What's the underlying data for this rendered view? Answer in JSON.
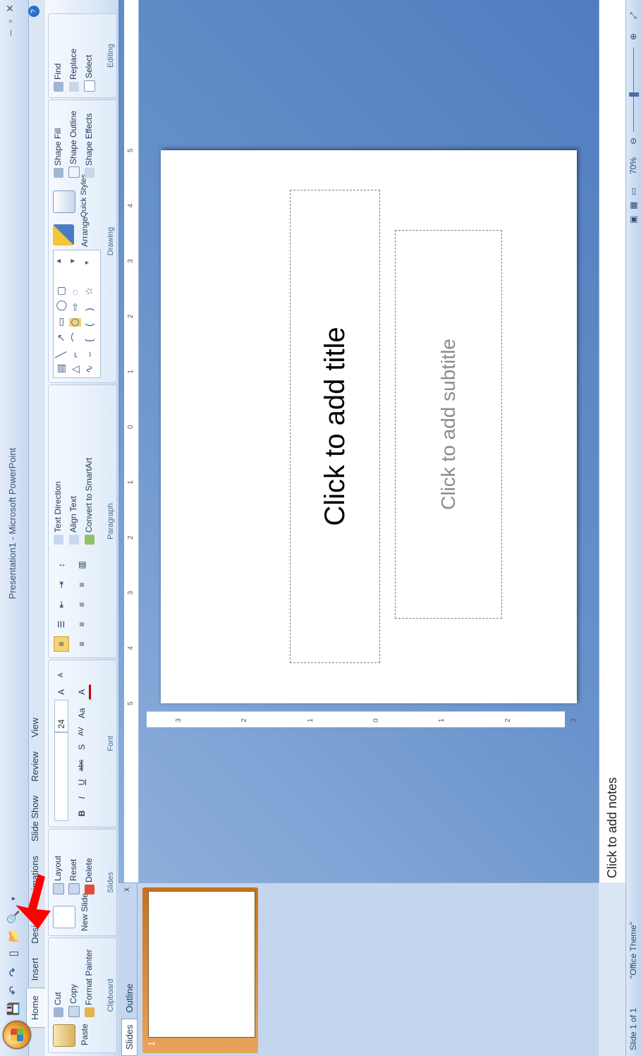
{
  "window": {
    "title": "Presentation1 - Microsoft PowerPoint",
    "controls": [
      "–",
      "▫",
      "✕"
    ]
  },
  "quick_access": [
    "save-icon",
    "undo-icon",
    "redo-icon",
    "new-icon",
    "open-icon",
    "print-preview-icon"
  ],
  "tabs": [
    "Home",
    "Insert",
    "Design",
    "Animations",
    "Slide Show",
    "Review",
    "View"
  ],
  "active_tab": "Home",
  "ribbon": {
    "clipboard": {
      "label": "Clipboard",
      "paste": "Paste",
      "cut": "Cut",
      "copy": "Copy",
      "format_painter": "Format Painter"
    },
    "slides": {
      "label": "Slides",
      "new_slide": "New Slide",
      "layout": "Layout",
      "reset": "Reset",
      "delete": "Delete"
    },
    "font": {
      "label": "Font",
      "font_name": "",
      "font_size": "24",
      "bold": "B",
      "italic": "I",
      "underline": "U",
      "strike": "abc",
      "shadow": "S",
      "spacing": "AV",
      "case": "Aa",
      "grow": "A",
      "shrink": "A",
      "clear": "A",
      "color": "A"
    },
    "paragraph": {
      "label": "Paragraph",
      "text_direction": "Text Direction",
      "align_text": "Align Text",
      "smartart": "Convert to SmartArt"
    },
    "drawing": {
      "label": "Drawing",
      "arrange": "Arrange",
      "quick_styles": "Quick Styles",
      "shape_fill": "Shape Fill",
      "shape_outline": "Shape Outline",
      "shape_effects": "Shape Effects"
    },
    "editing": {
      "label": "Editing",
      "find": "Find",
      "replace": "Replace",
      "select": "Select"
    }
  },
  "panel": {
    "tabs": [
      "Slides",
      "Outline"
    ],
    "active": "Slides",
    "close": "x",
    "slide_number": "1"
  },
  "rulers": {
    "h_ticks": [
      "5",
      "4",
      "3",
      "2",
      "1",
      "0",
      "1",
      "2",
      "3",
      "4",
      "5"
    ],
    "v_ticks": [
      "3",
      "2",
      "1",
      "0",
      "1",
      "2",
      "3"
    ]
  },
  "slide": {
    "title_placeholder": "Click to add title",
    "subtitle_placeholder": "Click to add subtitle"
  },
  "notes": {
    "placeholder": "Click to add notes"
  },
  "status": {
    "slide_info": "Slide 1 of 1",
    "theme": "\"Office Theme\"",
    "zoom": "70%"
  },
  "colors": {
    "ribbon": "#dae7f6",
    "accent": "#e8a04a",
    "annotation_arrow": "#ff0000"
  }
}
